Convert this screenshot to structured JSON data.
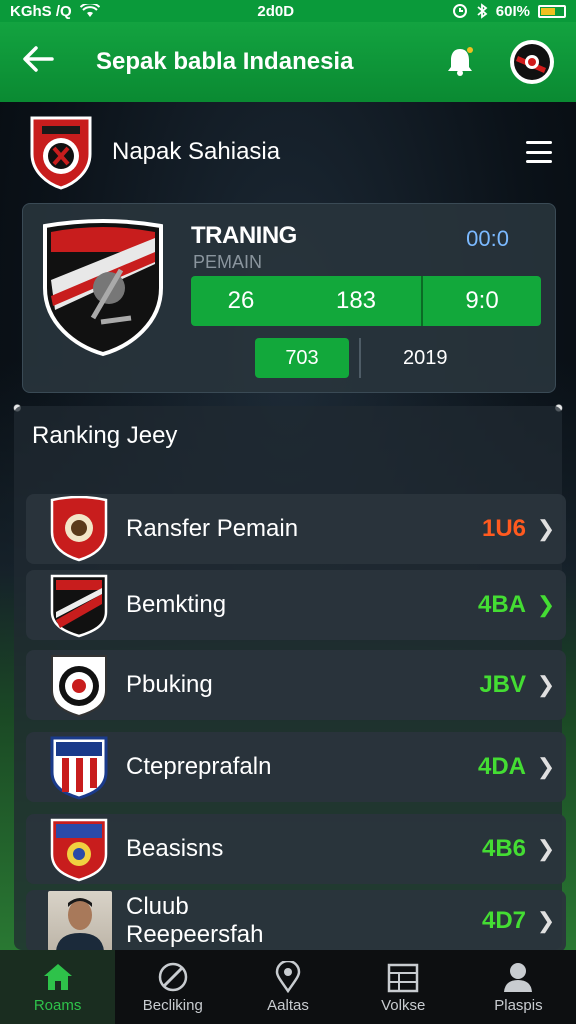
{
  "status_bar": {
    "left": "KGhS /Q",
    "time": "2d0D",
    "battery": "60I%"
  },
  "app_bar": {
    "title": "Sepak babla Indanesia"
  },
  "club": {
    "name": "Napak Sahiasia"
  },
  "training": {
    "title": "TRANING",
    "subtitle": "PEMAIN",
    "score": "00:0",
    "stat_a": "26",
    "stat_b": "183",
    "stat_c": "9:0",
    "stat_d": "703",
    "year": "2019"
  },
  "ranking": {
    "title": "Ranking Jeey",
    "rows": [
      {
        "label": "Ransfer Pemain",
        "value": "1U6",
        "color": "#ff5a1f"
      },
      {
        "label": "Bemkting",
        "value": "4BA",
        "color": "#44dd33"
      },
      {
        "label": "Pbuking",
        "value": "JBV",
        "color": "#44dd33"
      },
      {
        "label": "Ctepreprafaln",
        "value": "4DA",
        "color": "#44dd33"
      },
      {
        "label": "Beasisns",
        "value": "4B6",
        "color": "#44dd33"
      },
      {
        "label": "Cluub Reepeersfah",
        "line1": "Cluub",
        "line2": "Reepeersfah",
        "value": "4D7",
        "color": "#44dd33"
      }
    ]
  },
  "bottom_nav": [
    {
      "label": "Roams",
      "icon": "home-icon",
      "active": true
    },
    {
      "label": "Becliking",
      "icon": "ball-icon"
    },
    {
      "label": "Aaltas",
      "icon": "location-icon"
    },
    {
      "label": "Volkse",
      "icon": "calendar-icon"
    },
    {
      "label": "Plaspis",
      "icon": "user-icon"
    }
  ],
  "colors": {
    "accent": "#12a83b",
    "orange": "#ff5a1f",
    "green_text": "#44dd33",
    "blue_text": "#7bb9ff"
  }
}
